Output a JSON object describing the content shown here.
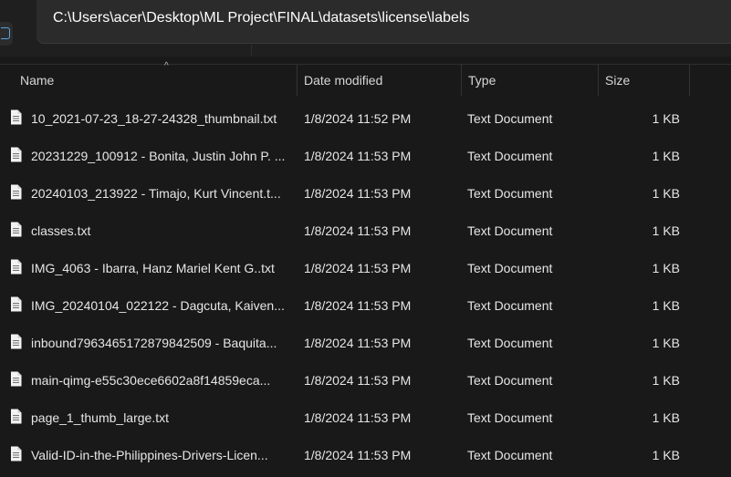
{
  "address_bar": {
    "path": "C:\\Users\\acer\\Desktop\\ML Project\\FINAL\\datasets\\license\\labels"
  },
  "columns": {
    "name": "Name",
    "date_modified": "Date modified",
    "type": "Type",
    "size": "Size"
  },
  "sort_indicator": "^",
  "files": [
    {
      "name": "10_2021-07-23_18-27-24328_thumbnail.txt",
      "date": "1/8/2024 11:52 PM",
      "type": "Text Document",
      "size": "1 KB"
    },
    {
      "name": "20231229_100912 - Bonita, Justin John P. ...",
      "date": "1/8/2024 11:53 PM",
      "type": "Text Document",
      "size": "1 KB"
    },
    {
      "name": "20240103_213922 - Timajo, Kurt Vincent.t...",
      "date": "1/8/2024 11:53 PM",
      "type": "Text Document",
      "size": "1 KB"
    },
    {
      "name": "classes.txt",
      "date": "1/8/2024 11:53 PM",
      "type": "Text Document",
      "size": "1 KB"
    },
    {
      "name": "IMG_4063 - Ibarra, Hanz Mariel Kent G..txt",
      "date": "1/8/2024 11:53 PM",
      "type": "Text Document",
      "size": "1 KB"
    },
    {
      "name": "IMG_20240104_022122 - Dagcuta, Kaiven...",
      "date": "1/8/2024 11:53 PM",
      "type": "Text Document",
      "size": "1 KB"
    },
    {
      "name": "inbound7963465172879842509 - Baquita...",
      "date": "1/8/2024 11:53 PM",
      "type": "Text Document",
      "size": "1 KB"
    },
    {
      "name": "main-qimg-e55c30ece6602a8f14859eca...",
      "date": "1/8/2024 11:53 PM",
      "type": "Text Document",
      "size": "1 KB"
    },
    {
      "name": "page_1_thumb_large.txt",
      "date": "1/8/2024 11:53 PM",
      "type": "Text Document",
      "size": "1 KB"
    },
    {
      "name": "Valid-ID-in-the-Philippines-Drivers-Licen...",
      "date": "1/8/2024 11:53 PM",
      "type": "Text Document",
      "size": "1 KB"
    }
  ],
  "icons": {
    "file": "text-file-icon",
    "side": "panel-icon"
  },
  "colors": {
    "background": "#191919",
    "address_bar": "#2b2b2b",
    "text": "#e6e6e6",
    "accent": "#5aa3e0"
  }
}
